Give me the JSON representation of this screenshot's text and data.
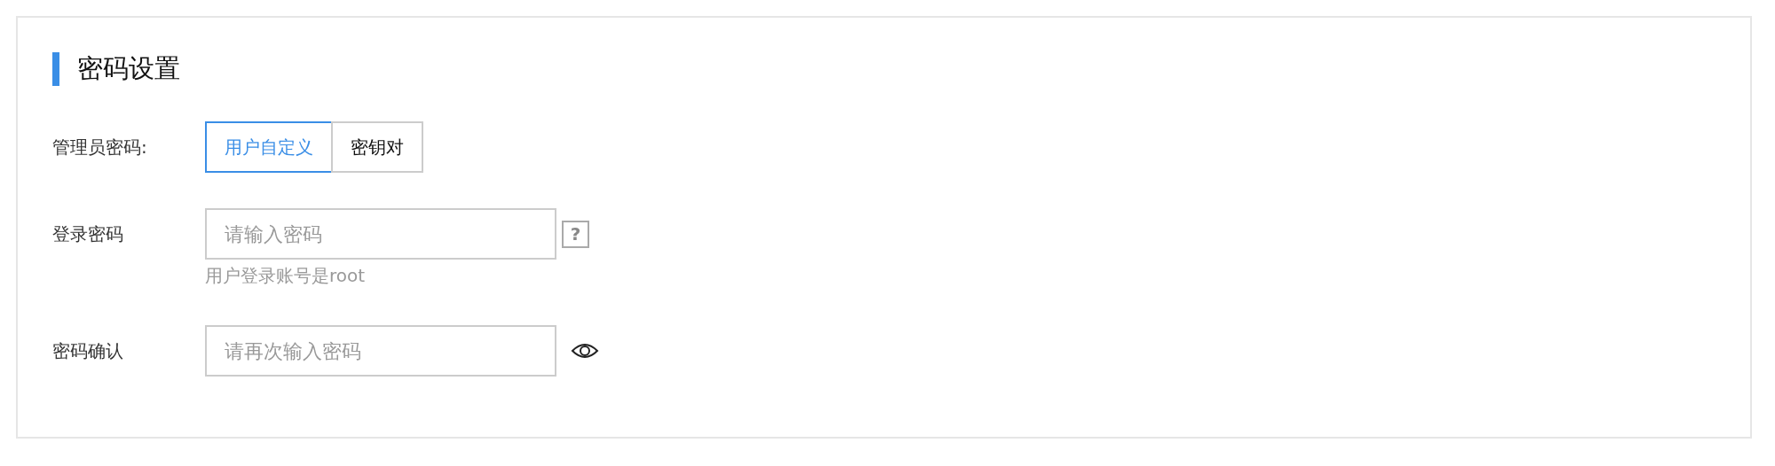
{
  "section": {
    "title": "密码设置"
  },
  "admin_password": {
    "label": "管理员密码:",
    "options": [
      {
        "label": "用户自定义",
        "selected": true
      },
      {
        "label": "密钥对",
        "selected": false
      }
    ]
  },
  "login_password": {
    "label": "登录密码",
    "placeholder": "请输入密码",
    "help": "?",
    "hint": "用户登录账号是root"
  },
  "confirm_password": {
    "label": "密码确认",
    "placeholder": "请再次输入密码"
  }
}
